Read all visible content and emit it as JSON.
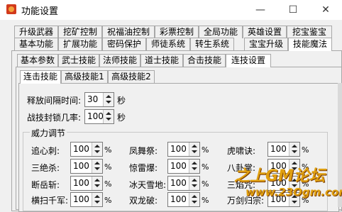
{
  "window": {
    "title": "功能设置",
    "minimize": "—",
    "maximize": "☐",
    "close": "✕"
  },
  "main_tabs_row1": [
    "升级武器",
    "挖矿控制",
    "祝福油控制",
    "彩票控制",
    "全局功能",
    "英雄设置",
    "挖宝鉴宝"
  ],
  "main_tabs_row2": [
    "基本功能",
    "扩展功能",
    "密码保护",
    "师徒系统",
    "转生系统",
    "宝宝升级",
    "技能魔法"
  ],
  "sub_tabs": [
    "基本参数",
    "武士技能",
    "法师技能",
    "道士技能",
    "合击技能",
    "连技设置"
  ],
  "inner_tabs": [
    "连击技能",
    "高级技能1",
    "高级技能2"
  ],
  "settings": {
    "interval": {
      "label": "释放间隔时间:",
      "value": "30",
      "unit": "秒"
    },
    "chain_lock": {
      "label": "战技封锁几率:",
      "value": "100",
      "unit": "秒"
    }
  },
  "power_group": {
    "title": "威力调节",
    "unit": "%",
    "rows": [
      [
        {
          "label": "追心刺:",
          "value": "100"
        },
        {
          "label": "凤舞祭:",
          "value": "100"
        },
        {
          "label": "虎啸诀:",
          "value": "100"
        }
      ],
      [
        {
          "label": "三绝杀:",
          "value": "100"
        },
        {
          "label": "惊雷爆:",
          "value": "100"
        },
        {
          "label": "八卦掌:",
          "value": "100"
        }
      ],
      [
        {
          "label": "断岳斩:",
          "value": "100"
        },
        {
          "label": "冰天雪地:",
          "value": "100"
        },
        {
          "label": "三焰咒:",
          "value": "100"
        }
      ],
      [
        {
          "label": "横扫千军:",
          "value": "100"
        },
        {
          "label": "双龙破:",
          "value": "100"
        },
        {
          "label": "万剑归宗:",
          "value": "100"
        }
      ]
    ]
  },
  "watermark": {
    "line1": "之上GM论坛",
    "line2": "www.23Ogm.com"
  }
}
